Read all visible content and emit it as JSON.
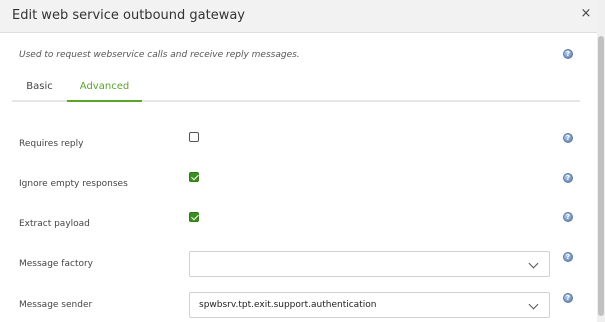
{
  "dialog": {
    "title": "Edit web service outbound gateway",
    "close_glyph": "×"
  },
  "description": "Used to request webservice calls and receive reply messages.",
  "help_glyph": "?",
  "tabs": [
    {
      "label": "Basic",
      "active": false
    },
    {
      "label": "Advanced",
      "active": true
    }
  ],
  "fields": {
    "requires_reply": {
      "label": "Requires reply",
      "checked": false
    },
    "ignore_empty_responses": {
      "label": "Ignore empty responses",
      "checked": true
    },
    "extract_payload": {
      "label": "Extract payload",
      "checked": true
    },
    "message_factory": {
      "label": "Message factory",
      "value": ""
    },
    "message_sender": {
      "label": "Message sender",
      "value": "spwbsrv.tpt.exit.support.authentication"
    }
  },
  "colors": {
    "accent": "#5aa52a",
    "checkbox_checked": "#3a8f1f",
    "header_bg": "#f2f2f2",
    "help_icon": "#6f8fbd"
  },
  "icons": {
    "close": "close-icon",
    "help": "help-icon",
    "dropdown": "chevron-down-icon",
    "check": "checkmark-icon"
  }
}
